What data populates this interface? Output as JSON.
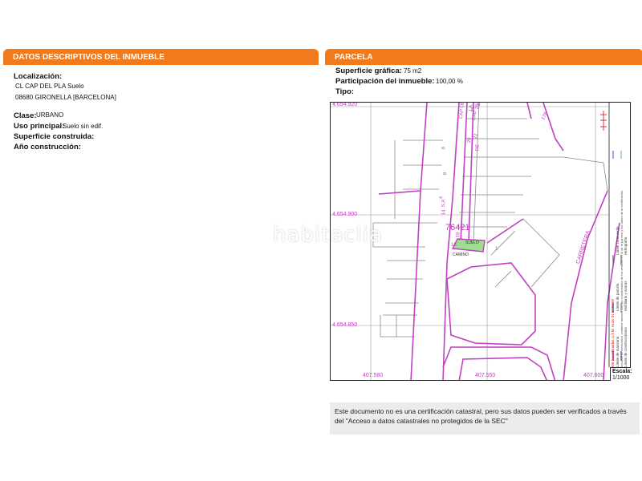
{
  "left_section": {
    "title": "DATOS DESCRIPTIVOS DEL INMUEBLE",
    "localizacion_label": "Localización:",
    "localizacion_line1": "CL CAP DEL PLA  Suelo",
    "localizacion_line2": "08680 GIRONELLA [BARCELONA]",
    "clase_label": "Clase:",
    "clase_value": "URBANO",
    "uso_label": "Uso principal:",
    "uso_value": "Suelo sin edif.",
    "superficie_construida_label": "Superficie construida:",
    "ano_label": "Año construcción:"
  },
  "right_section": {
    "title": "PARCELA",
    "superficie_label": "Superficie gráfica:",
    "superficie_value": "75 m2",
    "participacion_label": "Participación del inmueble:",
    "participacion_value": "100,00 %",
    "tipo_label": "Tipo:"
  },
  "map": {
    "coord_top": "4.654.920",
    "coord_mid": "4.654.900",
    "coord_low": "4.654.850",
    "coord_bottom_left": "407.580",
    "coord_bottom_mid": "407.550",
    "coord_bottom_right": "407.600",
    "parcel_number": "76421",
    "parcel_label": "SUELO",
    "parcel_sub": "CAMINO",
    "carretera": "CARRETERA",
    "scale_label": "Escala:",
    "scale_value": "1/1000",
    "legend_line1": "Límite de manzana",
    "legend_line2": "Límite de parcela",
    "legend_line3": "Límite de construcciones",
    "legend_line4": "Mobiliario y aceras",
    "legend_line5": "Límite zona verde",
    "legend_line6": "Hidrografía",
    "legend_red": "407.600 Coordenadas U.T.M. Huso 31 ETRS89",
    "legend_note": "Este documento electrónico contiene anexos con las coordenadas de los vértices UTM de la parcela y los datos de la certificación",
    "street_labels": [
      "S.P.",
      "CAP DEL PLA",
      "CAL",
      "DE",
      "LA",
      "20",
      "22",
      "24",
      "26",
      "28",
      "17B",
      "8",
      "6",
      "4",
      "1",
      "19",
      "16",
      "14"
    ],
    "colors": {
      "parcel_line": "#c040c0",
      "parcel_fill": "#9be08f",
      "legend_red": "#d01010"
    }
  },
  "note": {
    "text": "Este documento no es una certificación catastral, pero sus datos pueden ser verificados a través del \"Acceso a datos catastrales no protegidos de la SEC\""
  },
  "watermark": "habitaclia"
}
